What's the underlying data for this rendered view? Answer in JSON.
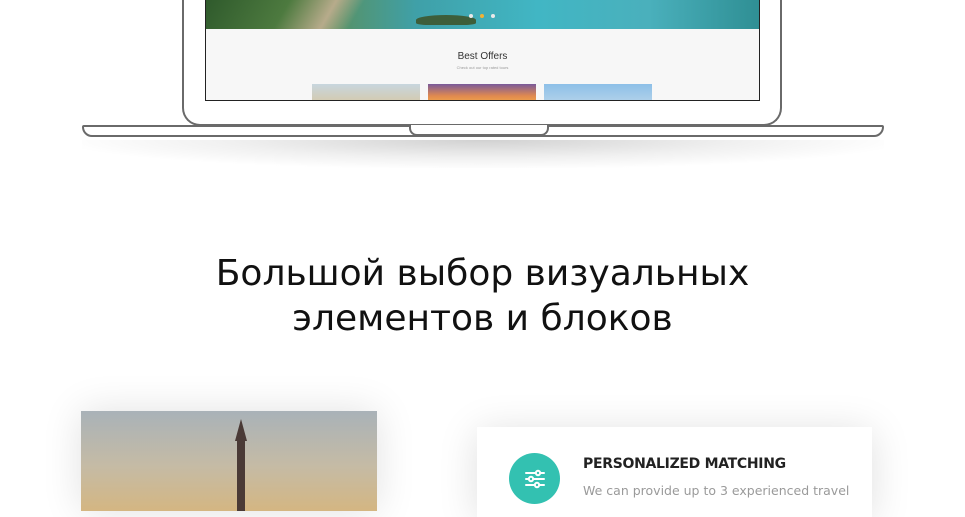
{
  "mockup": {
    "offers_title": "Best Offers",
    "offers_subtitle": "Check out our top rated tours"
  },
  "headline": {
    "line1": "Большой выбор визуальных",
    "line2": "элементов и блоков"
  },
  "feature": {
    "icon": "sliders-icon",
    "title": "PERSONALIZED MATCHING",
    "text": "We can provide up to 3 experienced travel"
  },
  "colors": {
    "accent_teal": "#33c1b1",
    "slider_active": "#f3b233"
  }
}
